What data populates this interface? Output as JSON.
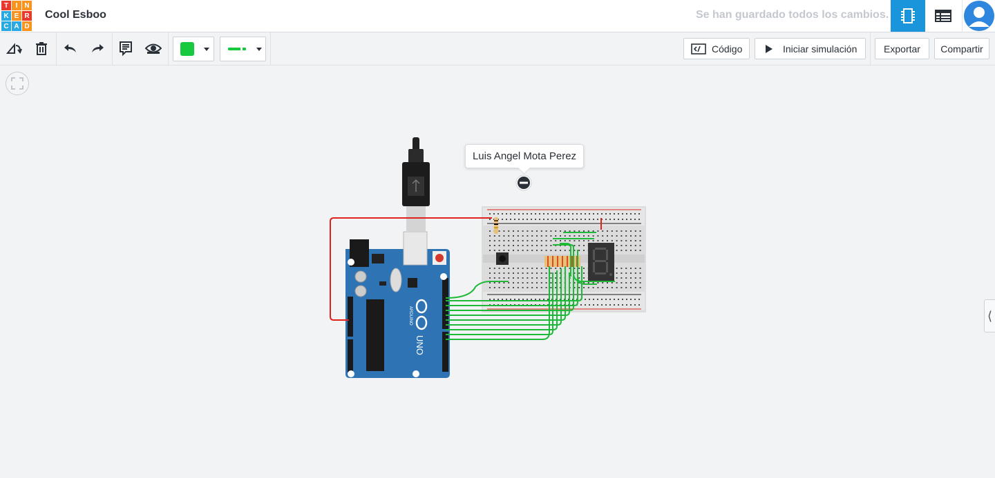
{
  "app": {
    "logo_letters": [
      "T",
      "I",
      "N",
      "K",
      "E",
      "R",
      "C",
      "A",
      "D"
    ],
    "logo_colors": [
      "#e8392d",
      "#f7931e",
      "#f7931e",
      "#28a9e1",
      "#f7931e",
      "#e8392d",
      "#28a9e1",
      "#28a9e1",
      "#f7931e"
    ],
    "project_title": "Cool Esboo",
    "save_status": "Se han guardado todos los cambios."
  },
  "toolbar": {
    "fill_color": "#17c93e",
    "wire_color": "#17c93e",
    "code_label": "Código",
    "simulate_label": "Iniciar simulación",
    "export_label": "Exportar",
    "share_label": "Compartir"
  },
  "canvas": {
    "note_author": "Luis Angel Mota Perez",
    "board_brand": "ARDUINO",
    "board_model": "UNO",
    "wire_colors": {
      "signal": "#1fb93a",
      "power": "#e0201b",
      "board": "#2e74b5"
    }
  },
  "icons": {
    "rotate": "rotate-icon",
    "delete": "trash-icon",
    "undo": "undo-icon",
    "redo": "redo-icon",
    "notes": "notes-icon",
    "visibility": "eye-icon",
    "components": "chip-icon",
    "list": "table-icon",
    "avatar": "user-icon"
  }
}
